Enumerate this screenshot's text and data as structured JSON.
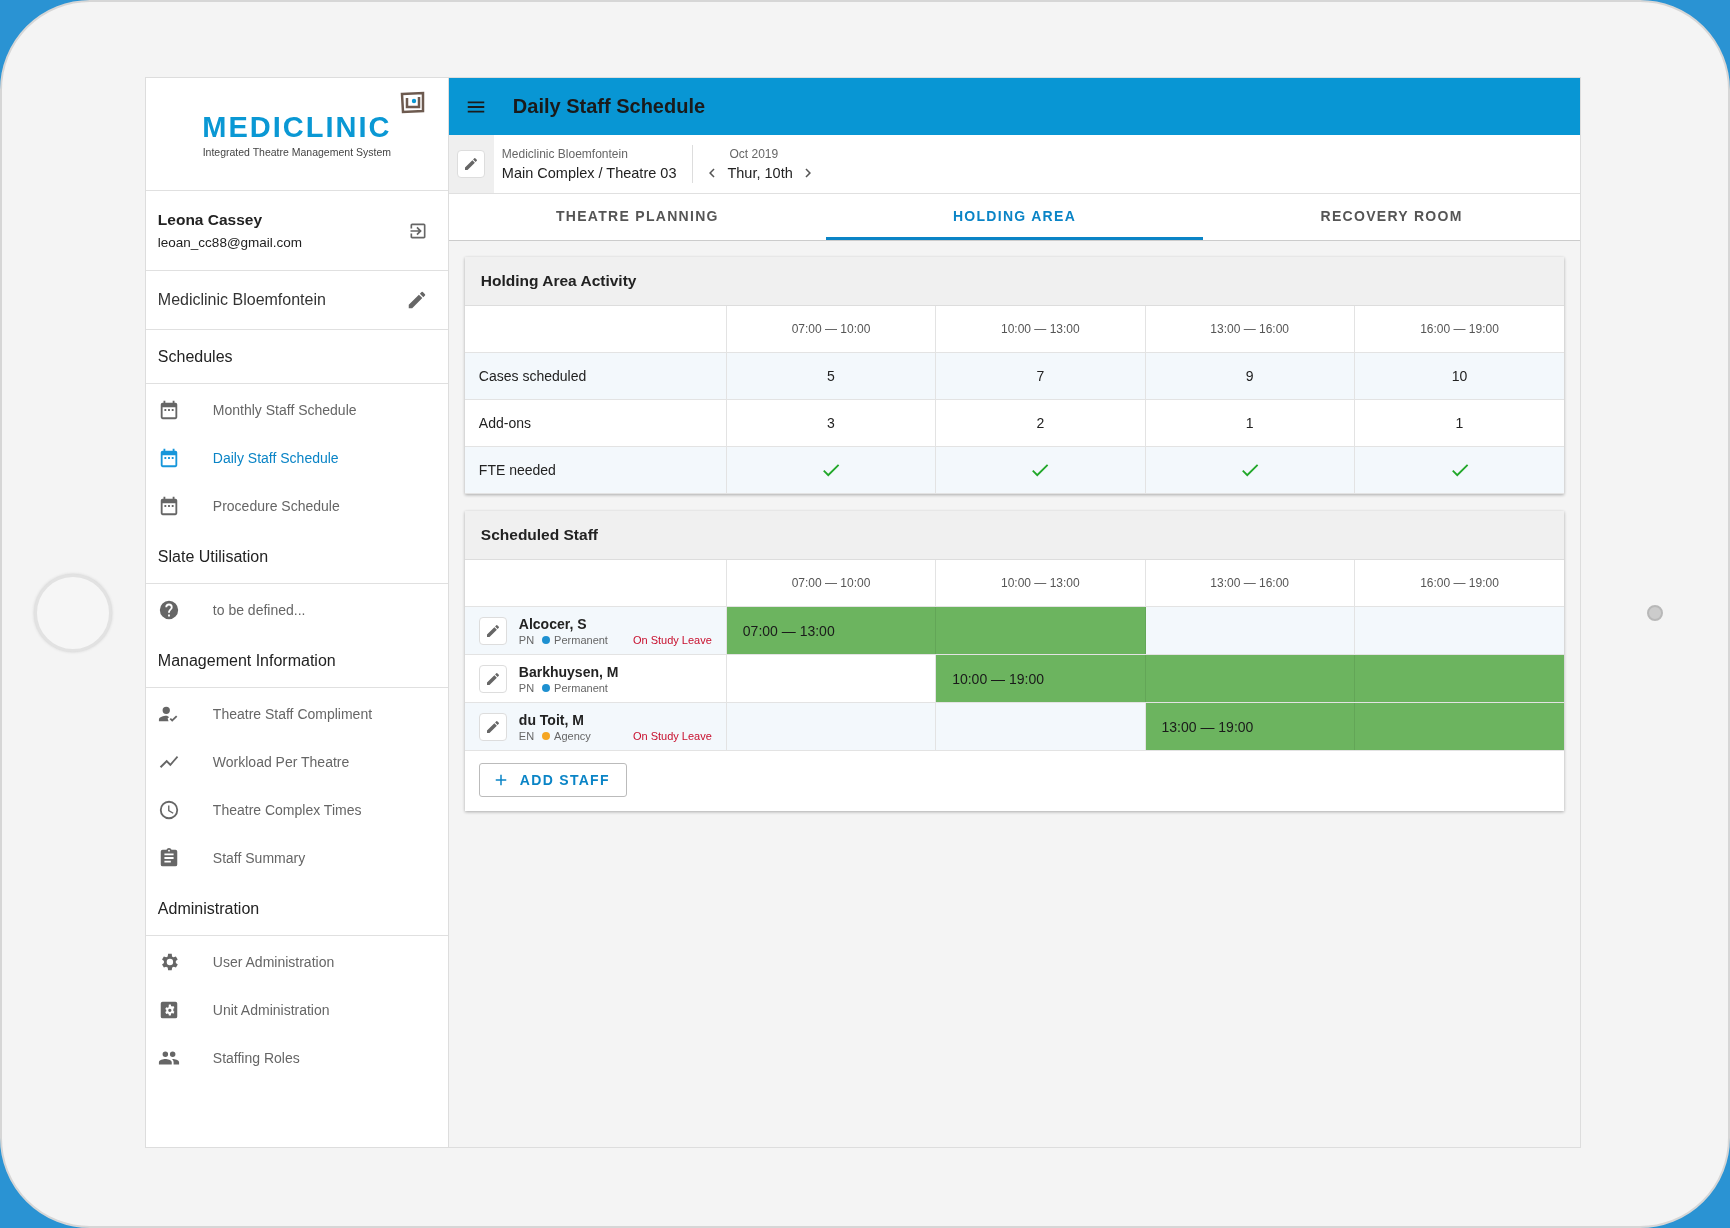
{
  "logo": {
    "name": "MEDICLINIC",
    "tagline": "Integrated Theatre Management System"
  },
  "user": {
    "name": "Leona Cassey",
    "email": "leoan_cc88@gmail.com"
  },
  "facility": "Mediclinic Bloemfontein",
  "sidebar": {
    "sections": [
      {
        "title": "Schedules",
        "items": [
          {
            "label": "Monthly Staff Schedule",
            "selected": false
          },
          {
            "label": "Daily Staff Schedule",
            "selected": true
          },
          {
            "label": "Procedure Schedule",
            "selected": false
          }
        ]
      },
      {
        "title": "Slate Utilisation",
        "items": [
          {
            "label": "to be defined...",
            "selected": false
          }
        ]
      },
      {
        "title": "Management Information",
        "items": [
          {
            "label": "Theatre Staff Compliment",
            "selected": false
          },
          {
            "label": "Workload Per Theatre",
            "selected": false
          },
          {
            "label": "Theatre Complex Times",
            "selected": false
          },
          {
            "label": "Staff Summary",
            "selected": false
          }
        ]
      },
      {
        "title": "Administration",
        "items": [
          {
            "label": "User Administration",
            "selected": false
          },
          {
            "label": "Unit Administration",
            "selected": false
          },
          {
            "label": "Staffing Roles",
            "selected": false
          }
        ]
      }
    ]
  },
  "app_bar": {
    "title": "Daily Staff Schedule"
  },
  "location": {
    "facility": "Mediclinic Bloemfontein",
    "theatre": "Main Complex / Theatre 03"
  },
  "date": {
    "month": "Oct 2019",
    "day": "Thur, 10th"
  },
  "tabs": [
    {
      "label": "THEATRE PLANNING",
      "selected": false
    },
    {
      "label": "HOLDING AREA",
      "selected": true
    },
    {
      "label": "RECOVERY ROOM",
      "selected": false
    }
  ],
  "activity": {
    "title": "Holding Area Activity",
    "columns": [
      "07:00 — 10:00",
      "10:00 — 13:00",
      "13:00 — 16:00",
      "16:00 — 19:00"
    ],
    "rows": [
      {
        "label": "Cases scheduled",
        "kind": "number",
        "cells": [
          "5",
          "7",
          "9",
          "10"
        ]
      },
      {
        "label": "Add-ons",
        "kind": "number",
        "cells": [
          "3",
          "2",
          "1",
          "1"
        ]
      },
      {
        "label": "FTE needed",
        "kind": "check",
        "checks": [
          true,
          true,
          true,
          true
        ]
      }
    ]
  },
  "staff": {
    "title": "Scheduled Staff",
    "columns": [
      "07:00 — 10:00",
      "10:00 — 13:00",
      "13:00 — 16:00",
      "16:00 — 19:00"
    ],
    "rows": [
      {
        "name": "Alcocer, S",
        "role": "PN",
        "employment": "Permanent",
        "color": "#1e90d0",
        "note": "On Study Leave",
        "slots": [
          {
            "filled": true,
            "label": "07:00 — 13:00"
          },
          {
            "filled": true
          },
          {
            "filled": false
          },
          {
            "filled": false
          }
        ]
      },
      {
        "name": "Barkhuysen, M",
        "role": "PN",
        "employment": "Permanent",
        "color": "#1e90d0",
        "slots": [
          {
            "filled": false
          },
          {
            "filled": true,
            "label": "10:00 — 19:00"
          },
          {
            "filled": true
          },
          {
            "filled": true
          }
        ]
      },
      {
        "name": "du Toit, M",
        "role": "EN",
        "employment": "Agency",
        "color": "#f5a623",
        "note": "On Study Leave",
        "slots": [
          {
            "filled": false
          },
          {
            "filled": false
          },
          {
            "filled": true,
            "label": "13:00 — 19:00"
          },
          {
            "filled": true
          }
        ]
      }
    ],
    "add_button": "ADD STAFF"
  }
}
